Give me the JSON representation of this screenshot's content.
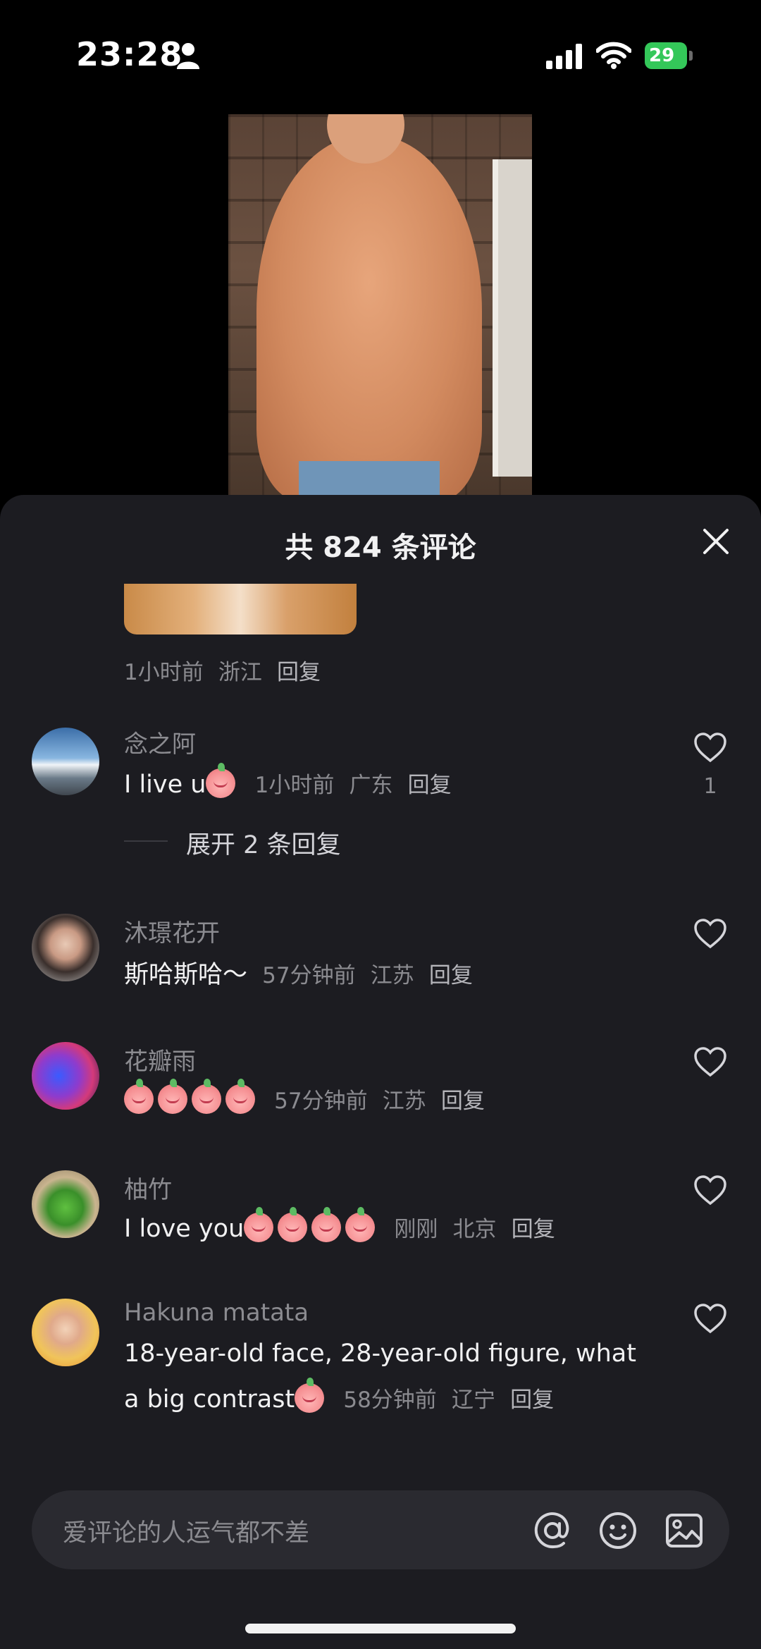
{
  "status_bar": {
    "time": "23:28",
    "battery": "29"
  },
  "sheet": {
    "title": "共 824 条评论",
    "close_icon": "close-icon"
  },
  "top_comment_meta": {
    "time": "1小时前",
    "region": "浙江",
    "reply": "回复"
  },
  "comments": [
    {
      "username": "念之阿",
      "text": "I live u",
      "emoji_count": 1,
      "time": "1小时前",
      "region": "广东",
      "reply": "回复",
      "likes": "1"
    },
    {
      "username": "沐璟花开",
      "text": "斯哈斯哈～",
      "emoji_count": 0,
      "time": "57分钟前",
      "region": "江苏",
      "reply": "回复",
      "likes": ""
    },
    {
      "username": "花瓣雨",
      "text": "",
      "emoji_count": 4,
      "time": "57分钟前",
      "region": "江苏",
      "reply": "回复",
      "likes": ""
    },
    {
      "username": "柚竹",
      "text": "I love you",
      "emoji_count": 4,
      "time": "刚刚",
      "region": "北京",
      "reply": "回复",
      "likes": ""
    },
    {
      "username": "Hakuna matata",
      "text_line1": "18-year-old face, 28-year-old figure, what",
      "text_line2": "a big contrast",
      "emoji_count": 1,
      "time": "58分钟前",
      "region": "辽宁",
      "reply": "回复",
      "likes": ""
    }
  ],
  "expand_replies": "展开 2 条回复",
  "input": {
    "placeholder": "爱评论的人运气都不差"
  },
  "colors": {
    "sheet_bg": "#1c1c21",
    "battery": "#34c759"
  }
}
